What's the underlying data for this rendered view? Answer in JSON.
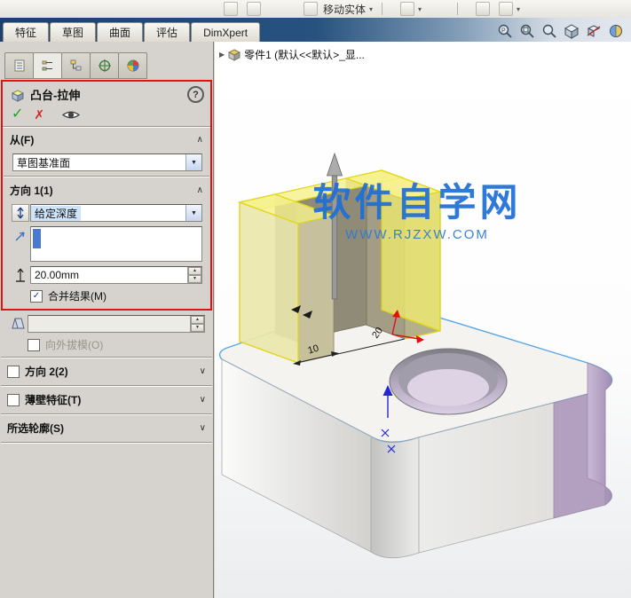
{
  "topbar": {
    "move_body_label": "移动实体"
  },
  "ribbon": {
    "tabs": [
      "特征",
      "草图",
      "曲面",
      "评估",
      "DimXpert"
    ]
  },
  "panel": {
    "title": "凸台-拉伸",
    "from": {
      "header": "从(F)",
      "plane_value": "草图基准面"
    },
    "direction1": {
      "header": "方向 1(1)",
      "end_condition": "给定深度",
      "depth_value": "20.00mm",
      "merge_result": "合并结果(M)",
      "draft_outward": "向外拔模(O)"
    },
    "direction2": {
      "header": "方向 2(2)"
    },
    "thin_feature": {
      "header": "薄壁特征(T)"
    },
    "selected_contours": {
      "header": "所选轮廓(S)"
    }
  },
  "viewport": {
    "feature_tree_label": "零件1 (默认<<默认>_显...",
    "watermark": {
      "title": "软件自学网",
      "url": "WWW.RJZXW.COM"
    },
    "dimensions": {
      "d10": "10",
      "d20": "20"
    }
  },
  "icons": {
    "collapse": "∧",
    "expand": "∨",
    "dropdown_arrow": "▼",
    "confirm": "✓",
    "cancel": "✗",
    "check": "✓",
    "help": "?",
    "spin_up": "▲",
    "spin_down": "▼",
    "tree_arrow": "▶",
    "toolbar_caret": "▾"
  },
  "colors": {
    "annotation_red": "#e01212",
    "selection_blue": "#4a7ad0",
    "preview_yellow": "#f0ea6e",
    "watermark_blue": "#1e6fd6"
  }
}
